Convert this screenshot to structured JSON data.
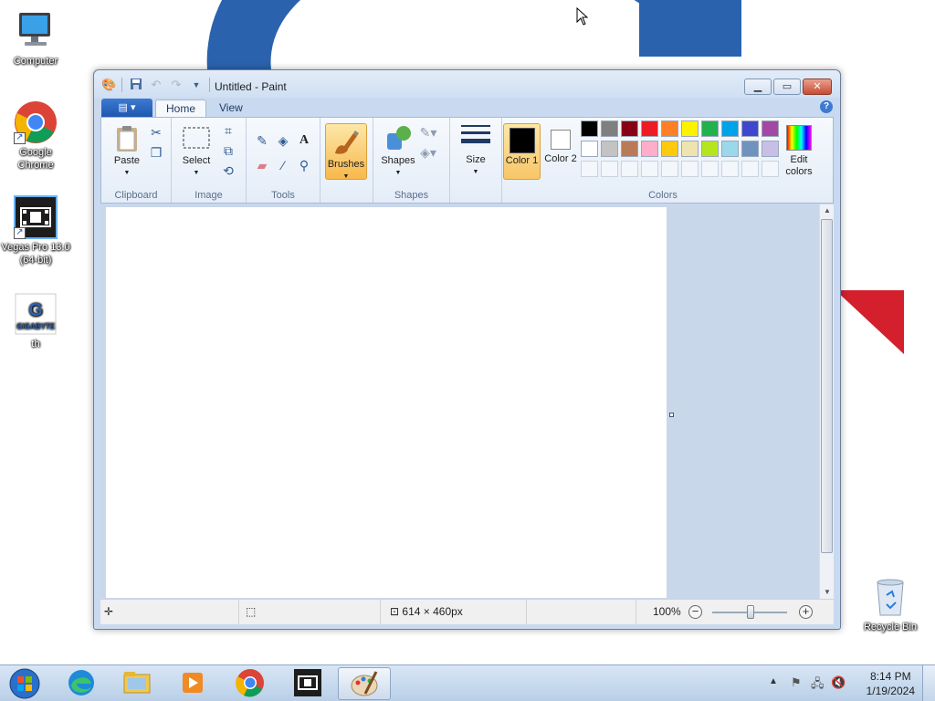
{
  "desktop": {
    "icons": [
      {
        "label": "Computer",
        "icon": "computer-icon"
      },
      {
        "label": "Google Chrome",
        "icon": "chrome-icon"
      },
      {
        "label": "Vegas Pro 13.0 (64-bit)",
        "icon": "vegas-icon"
      },
      {
        "label": "th",
        "icon": "gigabyte-icon",
        "logo_text": "GIGABYTE"
      },
      {
        "label": "Recycle Bin",
        "icon": "recycle-bin-icon"
      }
    ]
  },
  "window": {
    "title": "Untitled - Paint",
    "tabs": [
      {
        "label": "Home"
      },
      {
        "label": "View"
      }
    ],
    "active_tab": "Home"
  },
  "ribbon": {
    "groups": {
      "clipboard": {
        "label": "Clipboard",
        "paste": "Paste"
      },
      "image": {
        "label": "Image",
        "select": "Select"
      },
      "tools": {
        "label": "Tools"
      },
      "brushes": {
        "label": "Brushes"
      },
      "shapes": {
        "label": "Shapes",
        "shapes_btn": "Shapes"
      },
      "size": {
        "label": "Size"
      },
      "colors": {
        "label": "Colors",
        "color1": "Color 1",
        "color2": "Color 2",
        "edit_colors": "Edit colors",
        "color1_value": "#000000",
        "color2_value": "#ffffff",
        "palette_row1": [
          "#000000",
          "#7f7f7f",
          "#880015",
          "#ed1c24",
          "#ff7f27",
          "#fff200",
          "#22b14c",
          "#00a2e8",
          "#3f48cc",
          "#a349a4"
        ],
        "palette_row2": [
          "#ffffff",
          "#c3c3c3",
          "#b97a57",
          "#ffaec9",
          "#ffc90e",
          "#efe4b0",
          "#b5e61d",
          "#99d9ea",
          "#7092be",
          "#c8bfe7"
        ]
      }
    }
  },
  "statusbar": {
    "canvas_size": "614 × 460px",
    "zoom": "100%"
  },
  "taskbar": {
    "time": "8:14 PM",
    "date": "1/19/2024"
  }
}
